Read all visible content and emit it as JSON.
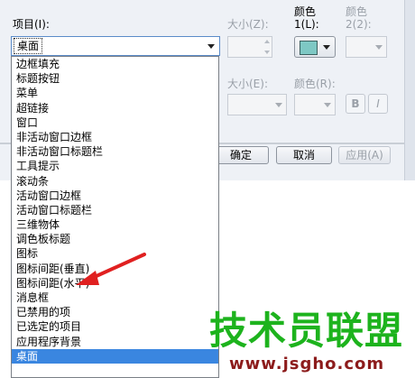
{
  "dialog": {
    "item_label": "项目(I):",
    "size1_label": "大小(Z):",
    "color1_label_line1": "颜色",
    "color1_label_line2": "1(L):",
    "color2_label_line1": "颜色",
    "color2_label_line2": "2(2):",
    "size2_label": "大小(E):",
    "fontcolor_label": "颜色(R):",
    "bold_label": "B",
    "italic_label": "I",
    "ok_label": "确定",
    "cancel_label": "取消",
    "apply_label": "应用(A)",
    "colors": {
      "swatch": "#7ec8c4",
      "selection": "#3a86e0"
    }
  },
  "item_select": {
    "current": "桌面",
    "options": [
      "边框填充",
      "标题按钮",
      "菜单",
      "超链接",
      "窗口",
      "非活动窗口边框",
      "非活动窗口标题栏",
      "工具提示",
      "滚动条",
      "活动窗口边框",
      "活动窗口标题栏",
      "三维物体",
      "调色板标题",
      "图标",
      "图标间距(垂直)",
      "图标间距(水平)",
      "消息框",
      "已禁用的项",
      "已选定的项目",
      "应用程序背景",
      "桌面"
    ],
    "selected_index": 20
  },
  "watermark": {
    "brand": "技术员联盟",
    "url": "www.jsgho.com"
  }
}
